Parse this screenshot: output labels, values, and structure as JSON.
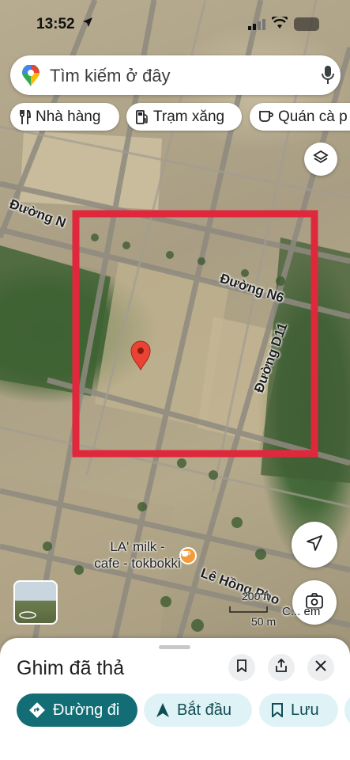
{
  "status_bar": {
    "time": "13:52",
    "location_arrow": "location-arrow-icon",
    "signal": "signal-icon",
    "wifi": "wifi-icon",
    "battery": "battery-icon"
  },
  "search": {
    "placeholder": "Tìm kiếm ở đây",
    "logo": "maps-pin-logo",
    "mic": "microphone-icon"
  },
  "chips": [
    {
      "label": "Nhà hàng",
      "icon": "restaurant-icon"
    },
    {
      "label": "Trạm xăng",
      "icon": "gas-station-icon"
    },
    {
      "label": "Quán cà p",
      "icon": "coffee-icon"
    }
  ],
  "map": {
    "road_labels": [
      "Đường N",
      "Đường N6",
      "Đường D11",
      "Lê Hồng Pho"
    ],
    "place_label": [
      "LA' milk -",
      "cafe - tokbokki"
    ],
    "scale_ft": "200 ft",
    "scale_m": "50 m",
    "lens_text": "C... em",
    "highlight_color": "#e0283c",
    "pin_color": "#ea4335"
  },
  "sheet": {
    "title": "Ghim đã thả",
    "actions": [
      {
        "label": "Đường đi",
        "icon": "directions-icon"
      },
      {
        "label": "Bắt đầu",
        "icon": "navigation-arrow-icon"
      },
      {
        "label": "Lưu",
        "icon": "bookmark-icon"
      }
    ],
    "accent": "#136d75"
  }
}
